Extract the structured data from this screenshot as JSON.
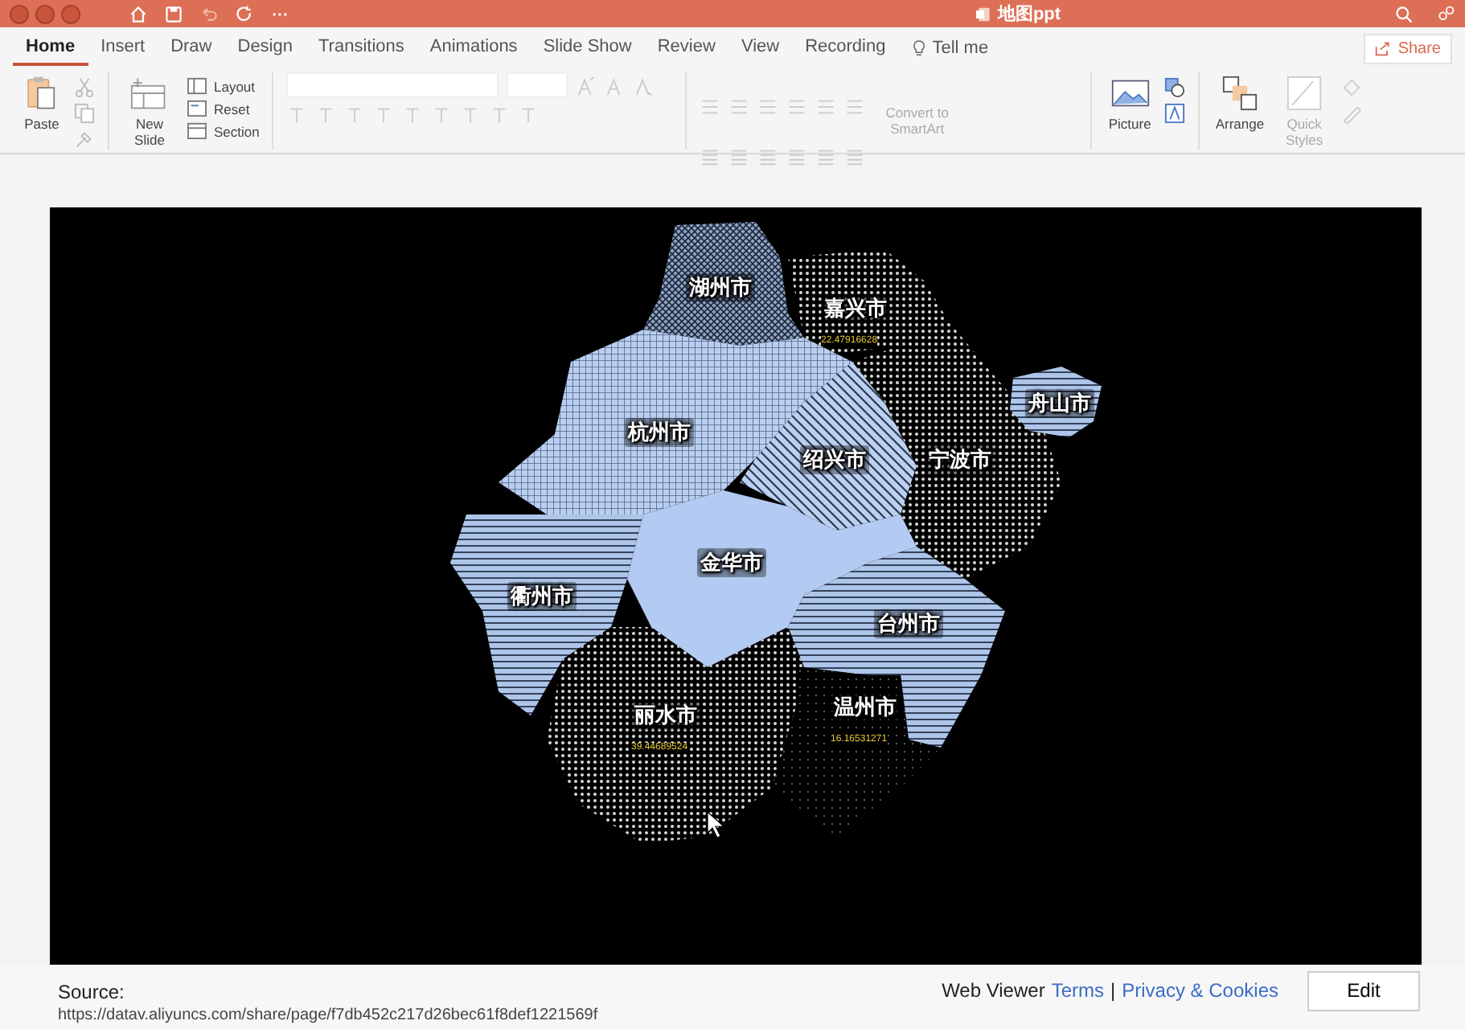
{
  "window": {
    "title": "地图ppt"
  },
  "tabs": [
    {
      "label": "Home",
      "selected": true
    },
    {
      "label": "Insert",
      "selected": false
    },
    {
      "label": "Draw",
      "selected": false
    },
    {
      "label": "Design",
      "selected": false
    },
    {
      "label": "Transitions",
      "selected": false
    },
    {
      "label": "Animations",
      "selected": false
    },
    {
      "label": "Slide Show",
      "selected": false
    },
    {
      "label": "Review",
      "selected": false
    },
    {
      "label": "View",
      "selected": false
    },
    {
      "label": "Recording",
      "selected": false
    }
  ],
  "tell_me": "Tell me",
  "share": "Share",
  "ribbon": {
    "paste": "Paste",
    "new_slide": "New Slide",
    "layout": "Layout",
    "reset": "Reset",
    "section": "Section",
    "convert": {
      "label": "Convert to SmartArt",
      "disabled": true
    },
    "picture": "Picture",
    "arrange": "Arrange",
    "quick_styles": {
      "label": "Quick Styles",
      "disabled": true
    }
  },
  "map": {
    "regions": [
      {
        "name": "湖州市",
        "kind": "crosshatch"
      },
      {
        "name": "嘉兴市",
        "value": "22.47916628",
        "kind": "dots"
      },
      {
        "name": "杭州市",
        "kind": "grid"
      },
      {
        "name": "绍兴市",
        "kind": "diagonal"
      },
      {
        "name": "宁波市",
        "kind": "dots"
      },
      {
        "name": "舟山市",
        "kind": "horizontal"
      },
      {
        "name": "衢州市",
        "kind": "horizontal"
      },
      {
        "name": "金华市",
        "kind": "solid"
      },
      {
        "name": "台州市",
        "kind": "horizontal"
      },
      {
        "name": "丽水市",
        "value": "39.44689524",
        "kind": "dots"
      },
      {
        "name": "温州市",
        "value": "16.16531271",
        "kind": "sparse"
      }
    ]
  },
  "footer": {
    "source_label": "Source:",
    "source_url": "https://datav.aliyuncs.com/share/page/f7db452c217d26bec61f8def1221569f",
    "viewer": "Web Viewer",
    "links": [
      "Terms",
      "Privacy & Cookies"
    ],
    "separator": "|",
    "edit": "Edit"
  }
}
